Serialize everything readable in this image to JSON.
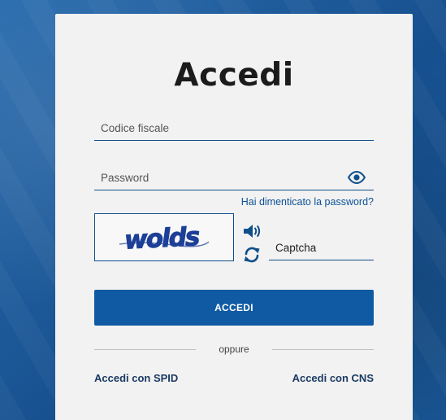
{
  "page": {
    "title": "Accedi"
  },
  "form": {
    "codice_fiscale_placeholder": "Codice fiscale",
    "password_placeholder": "Password",
    "forgot_password_link": "Hai dimenticato la password?",
    "captcha_image_text": "wolds",
    "captcha_placeholder": "Captcha",
    "login_button": "ACCEDI",
    "divider_text": "oppure"
  },
  "alt_login": {
    "spid_link": "Accedi con SPID",
    "cns_link": "Accedi con CNS"
  },
  "icons": {
    "password_toggle": "eye-icon",
    "captcha_audio": "speaker-icon",
    "captcha_refresh": "refresh-icon"
  },
  "colors": {
    "primary": "#0f5aa3",
    "link": "#0e5196",
    "background": "#1c5d9e",
    "card": "#f2f2f2",
    "captcha_text": "#1d3f97"
  }
}
